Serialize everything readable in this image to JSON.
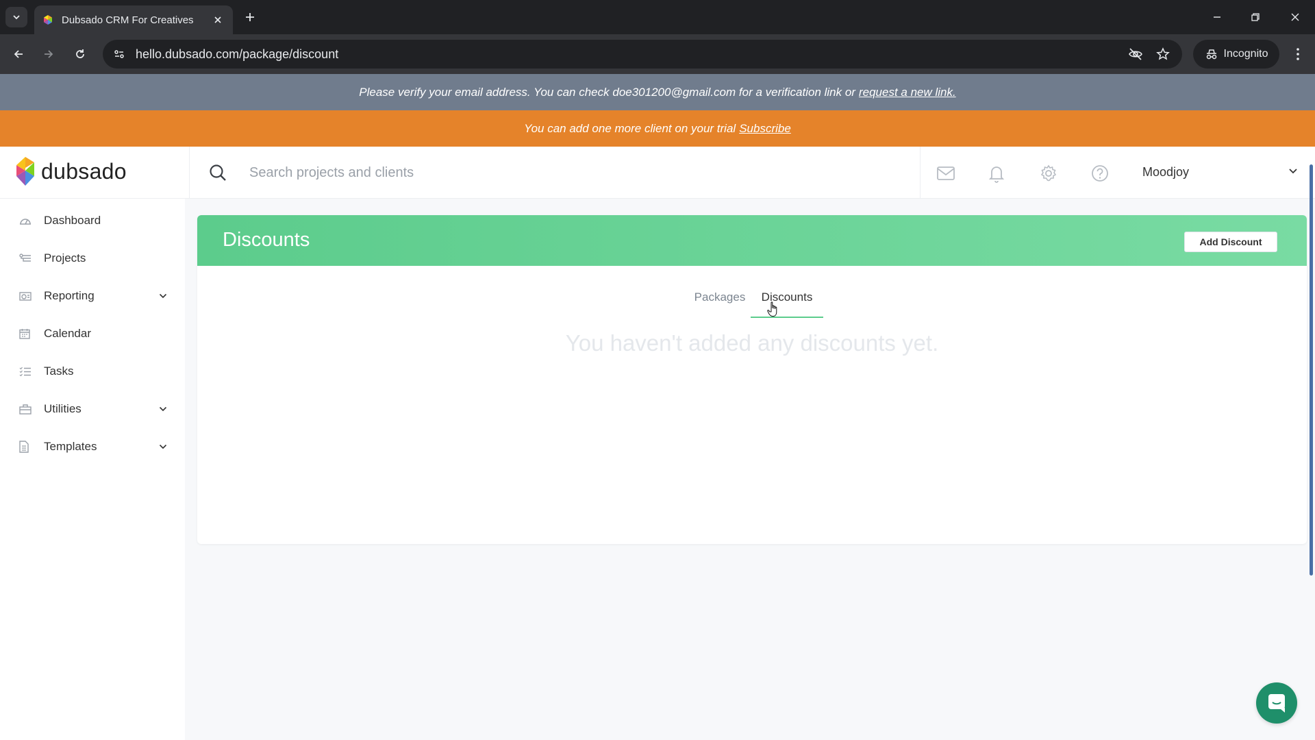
{
  "browser": {
    "tab_title": "Dubsado CRM For Creatives",
    "url": "hello.dubsado.com/package/discount",
    "incognito_label": "Incognito"
  },
  "banners": {
    "verify_text": "Please verify your email address. You can check doe301200@gmail.com for a verification link or",
    "verify_link": "request a new link.",
    "trial_text": "You can add one more client on your trial",
    "trial_link": "Subscribe"
  },
  "header": {
    "logo_text": "dubsado",
    "search_placeholder": "Search projects and clients",
    "user_name": "Moodjoy"
  },
  "sidebar": {
    "items": [
      {
        "label": "Dashboard",
        "icon": "dashboard-icon",
        "expandable": false
      },
      {
        "label": "Projects",
        "icon": "projects-icon",
        "expandable": false
      },
      {
        "label": "Reporting",
        "icon": "reporting-icon",
        "expandable": true
      },
      {
        "label": "Calendar",
        "icon": "calendar-icon",
        "expandable": false
      },
      {
        "label": "Tasks",
        "icon": "tasks-icon",
        "expandable": false
      },
      {
        "label": "Utilities",
        "icon": "utilities-icon",
        "expandable": true
      },
      {
        "label": "Templates",
        "icon": "templates-icon",
        "expandable": true
      }
    ]
  },
  "main": {
    "title": "Discounts",
    "add_button": "Add Discount",
    "tabs": [
      {
        "label": "Packages",
        "active": false
      },
      {
        "label": "Discounts",
        "active": true
      }
    ],
    "empty_message": "You haven't added any discounts yet."
  },
  "colors": {
    "accent_green": "#5ccc8c",
    "verify_banner": "#707c8d",
    "trial_banner": "#e5832a",
    "chat_button": "#1f8f6a"
  }
}
